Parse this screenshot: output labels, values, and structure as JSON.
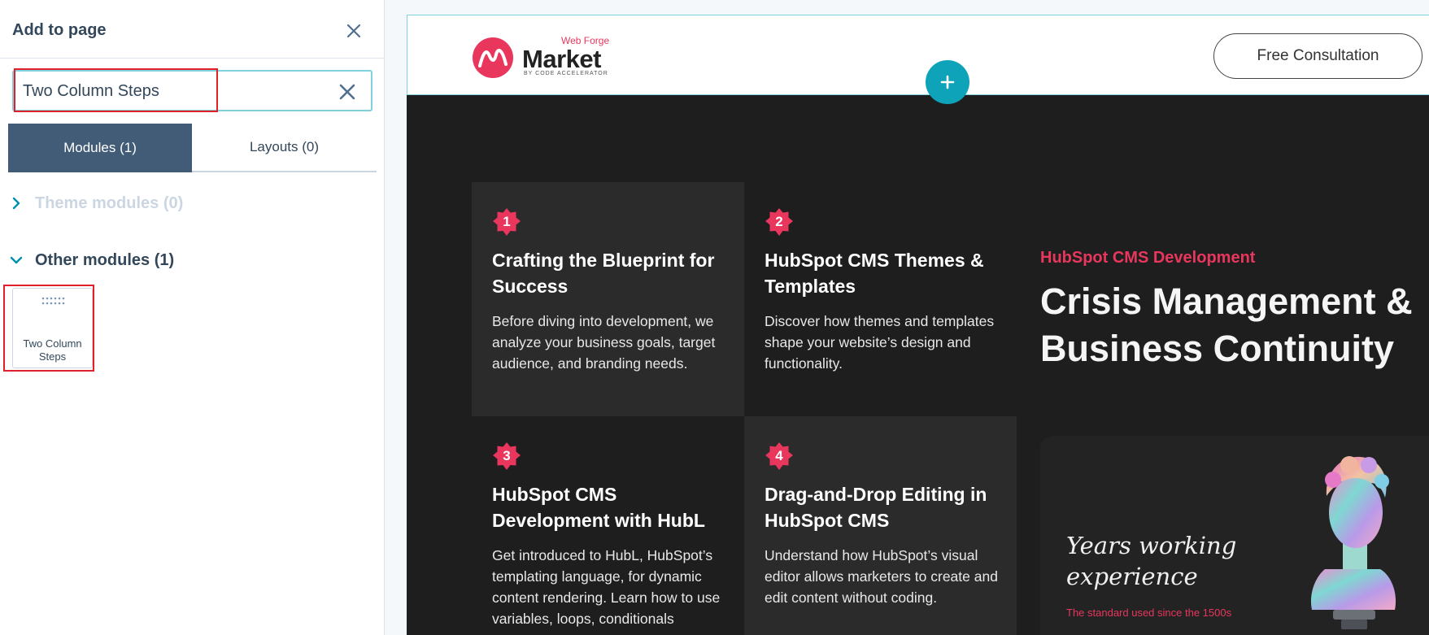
{
  "panel": {
    "title": "Add to page",
    "search": {
      "value": "Two Column Steps",
      "placeholder": ""
    },
    "tabs": [
      {
        "label": "Modules (1)",
        "active": true
      },
      {
        "label": "Layouts (0)",
        "active": false
      }
    ],
    "sections": [
      {
        "label": "Theme modules (0)",
        "expanded": false
      },
      {
        "label": "Other modules (1)",
        "expanded": true
      }
    ],
    "module_card": {
      "label": "Two Column Steps",
      "icon": "grip-dots-icon"
    }
  },
  "preview": {
    "logo": {
      "small": "Web Forge",
      "main": "Market",
      "sub": "BY CODE ACCELERATOR"
    },
    "cta_label": "Free Consultation",
    "add_button_icon": "plus-icon",
    "steps": [
      {
        "num": "1",
        "title": "Crafting the Blueprint for Success",
        "desc": "Before diving into development, we analyze your business goals, target audience, and branding needs."
      },
      {
        "num": "2",
        "title": "HubSpot CMS Themes & Templates",
        "desc": "Discover how themes and templates shape your website’s design and functionality."
      },
      {
        "num": "3",
        "title": "HubSpot CMS Development with HubL",
        "desc": "Get introduced to HubL, HubSpot’s templating language, for dynamic content rendering. Learn how to use variables, loops, conditionals"
      },
      {
        "num": "4",
        "title": "Drag-and-Drop Editing in HubSpot CMS",
        "desc": "Understand how HubSpot’s visual editor allows marketers to create and edit content without coding."
      }
    ],
    "kicker": "HubSpot CMS Development",
    "headline": "Crisis Management & Business Continuity",
    "experience": {
      "title": "Years working experience",
      "subtitle": "The standard used since the 1500s"
    }
  },
  "colors": {
    "panel_accent": "#425b76",
    "search_border": "#7fd1de",
    "highlight": "#e0202a",
    "brand_pink": "#e8365d",
    "dark_bg": "#1e1e1e",
    "add_button": "#0ea3b8"
  }
}
